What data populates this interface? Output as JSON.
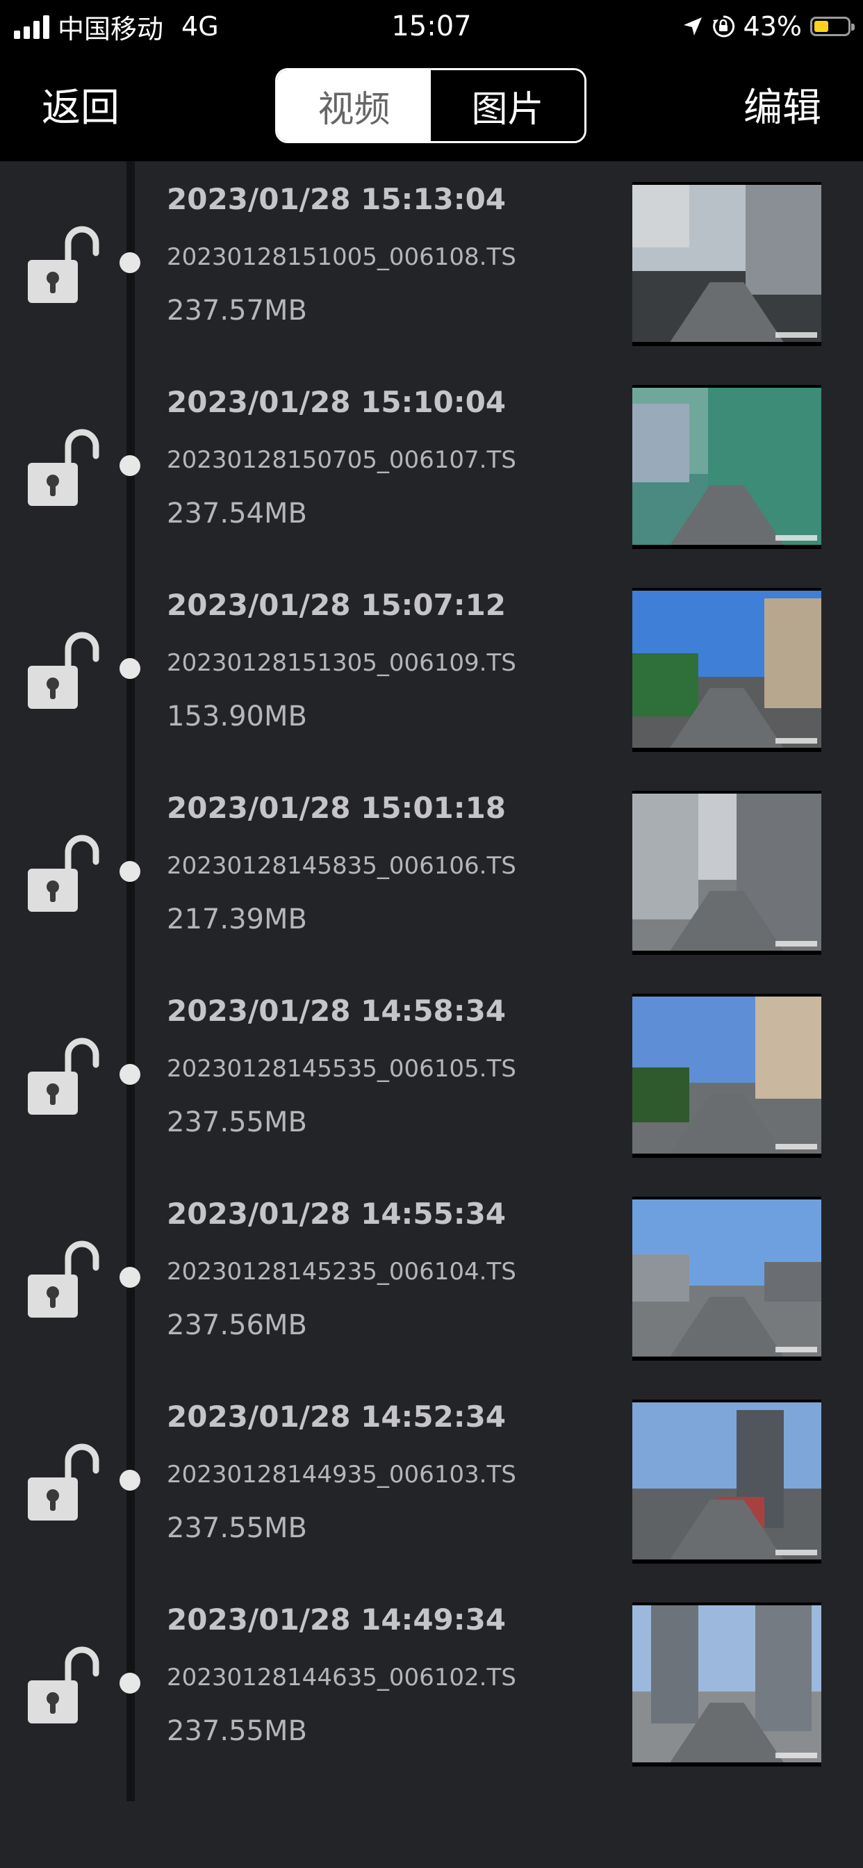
{
  "status_bar": {
    "carrier": "中国移动",
    "network": "4G",
    "time": "15:07",
    "battery_percent": "43%",
    "battery_level": 0.43,
    "icons": [
      "signal-icon",
      "location-arrow-icon",
      "orientation-lock-icon",
      "battery-icon"
    ]
  },
  "nav": {
    "back_label": "返回",
    "edit_label": "编辑",
    "segments": [
      {
        "label": "视频",
        "selected": true
      },
      {
        "label": "图片",
        "selected": false
      }
    ]
  },
  "colors": {
    "background": "#232428",
    "header": "#000000",
    "battery_fill": "#ffd21f",
    "text_primary": "#c5c5c8",
    "text_secondary": "#b6b6ba"
  },
  "videos": [
    {
      "datetime": "2023/01/28 15:13:04",
      "filename": "20230128151005_006108.TS",
      "size": "237.57MB",
      "lock_icon": "unlocked-padlock-icon"
    },
    {
      "datetime": "2023/01/28 15:10:04",
      "filename": "20230128150705_006107.TS",
      "size": "237.54MB",
      "lock_icon": "unlocked-padlock-icon"
    },
    {
      "datetime": "2023/01/28 15:07:12",
      "filename": "20230128151305_006109.TS",
      "size": "153.90MB",
      "lock_icon": "unlocked-padlock-icon"
    },
    {
      "datetime": "2023/01/28 15:01:18",
      "filename": "20230128145835_006106.TS",
      "size": "217.39MB",
      "lock_icon": "unlocked-padlock-icon"
    },
    {
      "datetime": "2023/01/28 14:58:34",
      "filename": "20230128145535_006105.TS",
      "size": "237.55MB",
      "lock_icon": "unlocked-padlock-icon"
    },
    {
      "datetime": "2023/01/28 14:55:34",
      "filename": "20230128145235_006104.TS",
      "size": "237.56MB",
      "lock_icon": "unlocked-padlock-icon"
    },
    {
      "datetime": "2023/01/28 14:52:34",
      "filename": "20230128144935_006103.TS",
      "size": "237.55MB",
      "lock_icon": "unlocked-padlock-icon"
    },
    {
      "datetime": "2023/01/28 14:49:34",
      "filename": "20230128144635_006102.TS",
      "size": "237.55MB",
      "lock_icon": "unlocked-padlock-icon"
    }
  ]
}
